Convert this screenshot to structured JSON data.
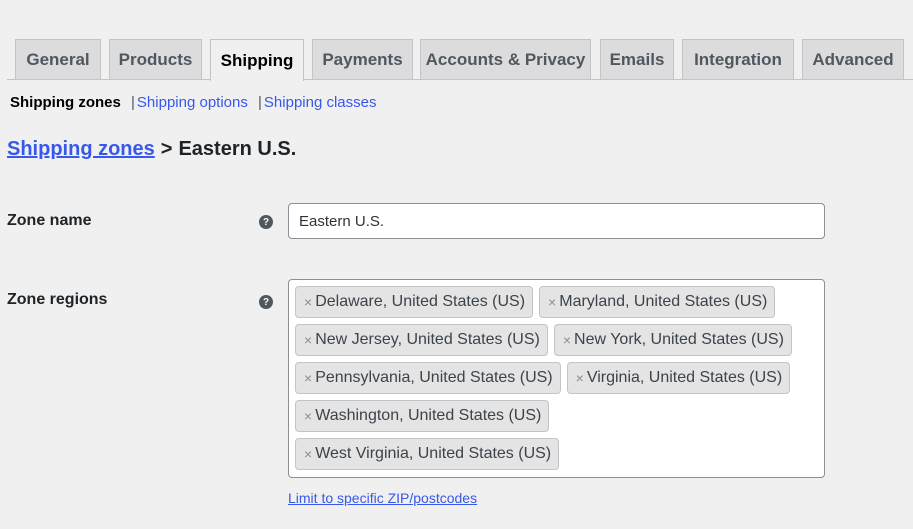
{
  "tabs": [
    {
      "label": "General",
      "active": false
    },
    {
      "label": "Products",
      "active": false
    },
    {
      "label": "Shipping",
      "active": true
    },
    {
      "label": "Payments",
      "active": false
    },
    {
      "label": "Accounts & Privacy",
      "active": false
    },
    {
      "label": "Emails",
      "active": false
    },
    {
      "label": "Integration",
      "active": false
    },
    {
      "label": "Advanced",
      "active": false
    }
  ],
  "subnav": {
    "current": "Shipping zones",
    "separator": "|",
    "links": [
      "Shipping options",
      "Shipping classes"
    ]
  },
  "breadcrumb": {
    "link": "Shipping zones",
    "separator": ">",
    "current": "Eastern U.S."
  },
  "form": {
    "zone_name_label": "Zone name",
    "zone_name_value": "Eastern U.S.",
    "zone_regions_label": "Zone regions",
    "help_icon_glyph": "?",
    "remove_glyph": "×",
    "regions": [
      "Delaware, United States (US)",
      "Maryland, United States (US)",
      "New Jersey, United States (US)",
      "New York, United States (US)",
      "Pennsylvania, United States (US)",
      "Virginia, United States (US)",
      "Washington, United States (US)",
      "West Virginia, United States (US)"
    ],
    "limit_link": "Limit to specific ZIP/postcodes"
  }
}
